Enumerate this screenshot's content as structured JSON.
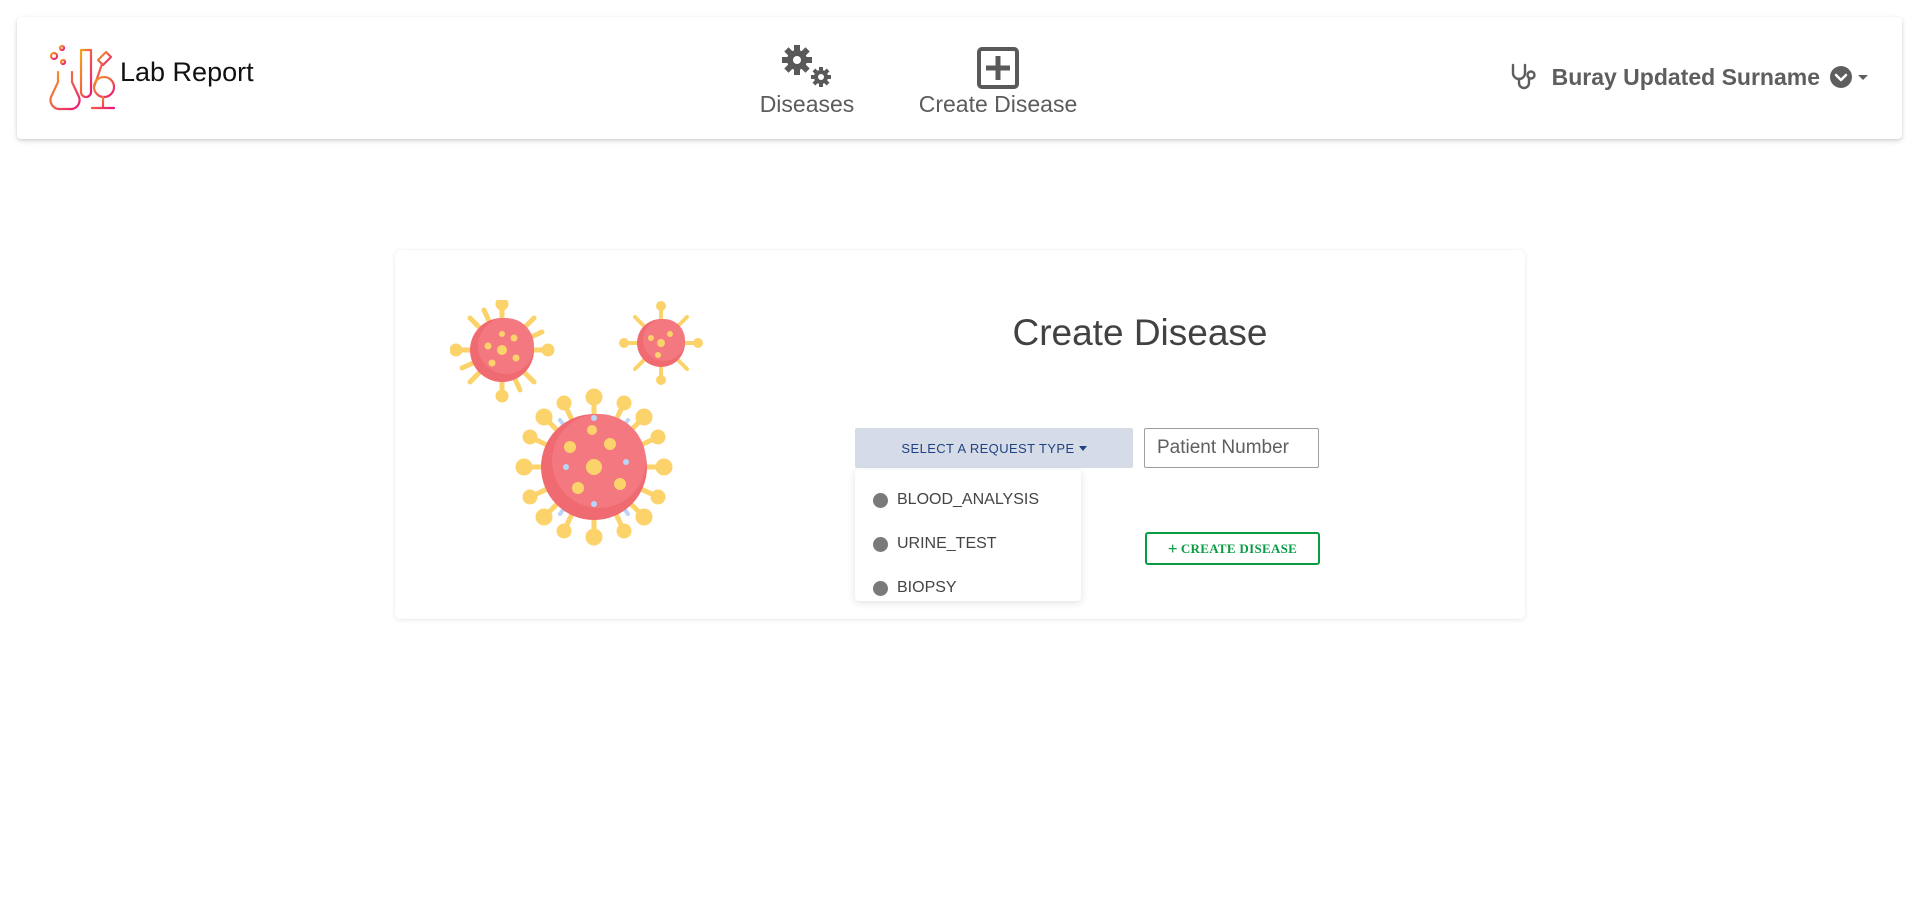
{
  "app": {
    "title": "Lab Report"
  },
  "nav": {
    "items": [
      {
        "label": "Diseases",
        "icon": "gears-icon"
      },
      {
        "label": "Create Disease",
        "icon": "plus-square-icon"
      }
    ]
  },
  "user": {
    "name": "Buray Updated Surname",
    "icon": "stethoscope-icon"
  },
  "form": {
    "title": "Create Disease",
    "request_type_button": "SELECT A REQUEST TYPE",
    "patient_number_placeholder": "Patient Number",
    "create_button": "CREATE DISEASE",
    "request_types": [
      "BLOOD_ANALYSIS",
      "URINE_TEST",
      "BIOPSY"
    ]
  },
  "colors": {
    "accent_green": "#0a9b45",
    "request_button_bg": "#d5dbe7",
    "request_button_text": "#1f4282",
    "virus_body": "#f06a72",
    "virus_spikes": "#fcd36b"
  }
}
